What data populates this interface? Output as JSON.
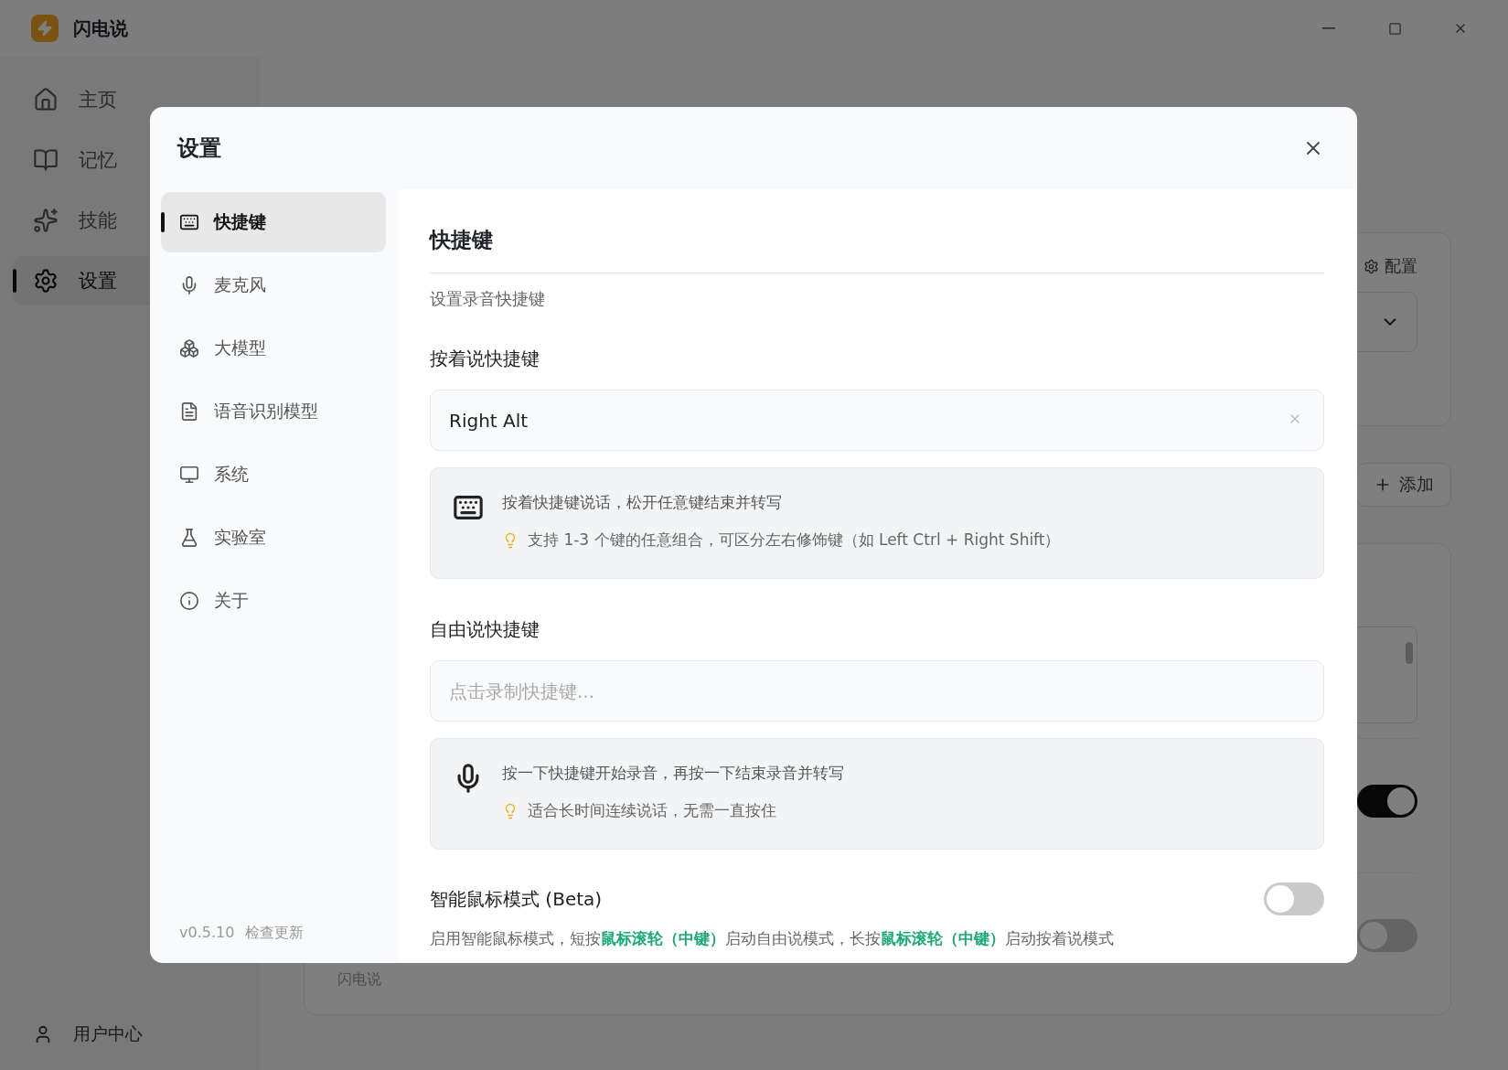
{
  "app": {
    "title": "闪电说",
    "nav": [
      {
        "label": "主页",
        "kind": "home",
        "selected": false
      },
      {
        "label": "记忆",
        "kind": "book",
        "selected": false
      },
      {
        "label": "技能",
        "kind": "sparkles",
        "selected": false
      },
      {
        "label": "设置",
        "kind": "settings",
        "selected": true
      }
    ],
    "user_center": "用户中心"
  },
  "background": {
    "config_button": "配置",
    "add_button": "添加",
    "toggles": [
      {
        "on": true
      },
      {
        "on": false
      }
    ],
    "caption": "闪电说"
  },
  "settings": {
    "title": "设置",
    "nav": [
      {
        "label": "快捷键",
        "kind": "keyboard",
        "selected": true
      },
      {
        "label": "麦克风",
        "kind": "mic",
        "selected": false
      },
      {
        "label": "大模型",
        "kind": "boxes",
        "selected": false
      },
      {
        "label": "语音识别模型",
        "kind": "file",
        "selected": false
      },
      {
        "label": "系统",
        "kind": "monitor",
        "selected": false
      },
      {
        "label": "实验室",
        "kind": "flask",
        "selected": false
      },
      {
        "label": "关于",
        "kind": "info",
        "selected": false
      }
    ],
    "version": "v0.5.10",
    "check_update": "检查更新",
    "section_title": "快捷键",
    "subtitle": "设置录音快捷键",
    "shortcuts": [
      {
        "label": "按着说快捷键",
        "value": "Right Alt",
        "kind": "keyboard",
        "text": "按着快捷键说话，松开任意键结束并转写",
        "tip": "支持 1-3 个键的任意组合，可区分左右修饰键（如 Left Ctrl + Right Shift）"
      },
      {
        "label": "自由说快捷键",
        "placeholder": "点击录制快捷键...",
        "kind": "mic",
        "text": "按一下快捷键开始录音，再按一下结束录音并转写",
        "tip": "适合长时间连续说话，无需一直按住"
      }
    ],
    "smart_mouse": {
      "label": "智能鼠标模式 (Beta)",
      "on": false,
      "description": "启用智能鼠标模式，短按**鼠标滚轮（中键）**启动自由说模式，长按**鼠标滚轮（中键）**启动按着说模式"
    }
  }
}
